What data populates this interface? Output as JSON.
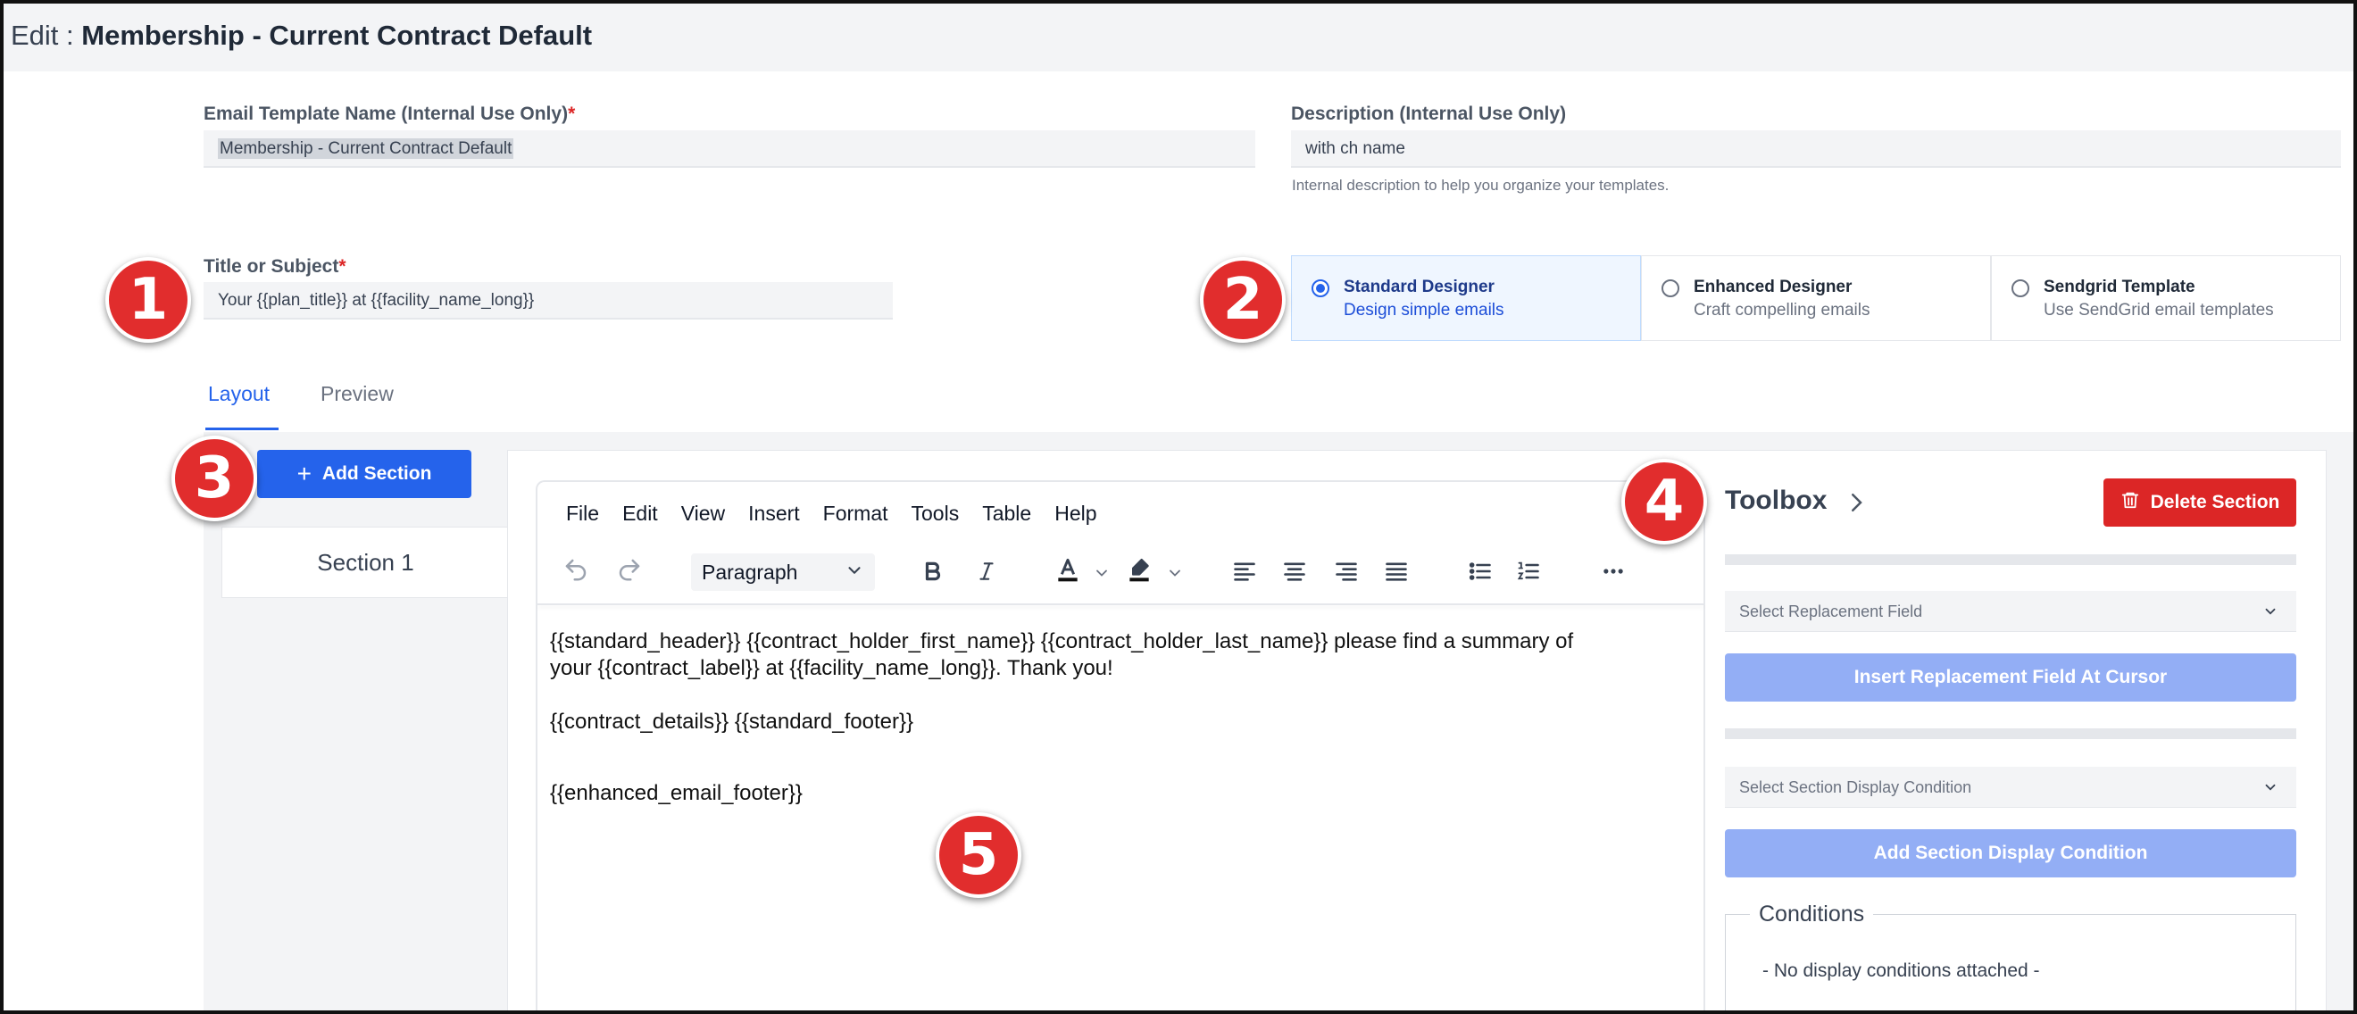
{
  "header": {
    "prefix": "Edit : ",
    "title": "Membership - Current Contract Default"
  },
  "template_name": {
    "label": "Email Template Name (Internal Use Only)",
    "required_mark": "*",
    "value": "Membership - Current Contract Default"
  },
  "description": {
    "label": "Description (Internal Use Only)",
    "value": "with ch name",
    "help": "Internal description to help you organize your templates."
  },
  "subject": {
    "label": "Title or Subject",
    "required_mark": "*",
    "value": "Your {{plan_title}} at {{facility_name_long}}"
  },
  "designers": [
    {
      "title": "Standard Designer",
      "subtitle": "Design simple emails",
      "selected": true
    },
    {
      "title": "Enhanced Designer",
      "subtitle": "Craft compelling emails",
      "selected": false
    },
    {
      "title": "Sendgrid Template",
      "subtitle": "Use SendGrid email templates",
      "selected": false
    }
  ],
  "tabs": {
    "layout": "Layout",
    "preview": "Preview",
    "active": "Layout"
  },
  "sections": {
    "add_label": "Add Section",
    "items": [
      "Section 1"
    ]
  },
  "editor": {
    "menu": [
      "File",
      "Edit",
      "View",
      "Insert",
      "Format",
      "Tools",
      "Table",
      "Help"
    ],
    "block_format": "Paragraph",
    "content": {
      "line1": "{{standard_header}} {{contract_holder_first_name}} {{contract_holder_last_name}} please find a summary of",
      "line2": "your {{contract_label}} at {{facility_name_long}}. Thank you!",
      "line3": "{{contract_details}}   {{standard_footer}}",
      "line4": "{{enhanced_email_footer}}"
    },
    "toolbar_icons": [
      "undo-icon",
      "redo-icon",
      "bold-icon",
      "italic-icon",
      "text-color-icon",
      "highlight-icon",
      "align-left-icon",
      "align-center-icon",
      "align-right-icon",
      "justify-icon",
      "bullet-list-icon",
      "numbered-list-icon",
      "more-icon"
    ]
  },
  "toolbox": {
    "title": "Toolbox",
    "delete_label": "Delete Section",
    "replacement_placeholder": "Select Replacement Field",
    "insert_label": "Insert Replacement Field At Cursor",
    "condition_placeholder": "Select Section Display Condition",
    "add_condition_label": "Add Section Display Condition",
    "conditions_title": "Conditions",
    "conditions_empty": "- No display conditions attached -"
  },
  "callouts": [
    "1",
    "2",
    "3",
    "4",
    "5"
  ],
  "colors": {
    "accent": "#2563eb",
    "danger": "#dc2626",
    "disabled_button": "#93aef5",
    "callout": "#e12d2d"
  }
}
